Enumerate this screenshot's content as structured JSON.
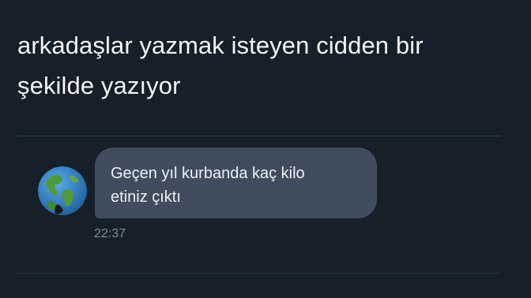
{
  "tweet": {
    "text_line1": "arkadaşlar yazmak isteyen cidden bir",
    "text_line2": "şekilde yazıyor"
  },
  "message": {
    "line1": "Geçen yıl kurbanda kaç kilo",
    "line2": "etiniz çıktı",
    "time": "22:37",
    "avatar_icon": "earth-globe-icon"
  },
  "colors": {
    "background": "#15202b",
    "bubble": "#3f4d5e",
    "text": "#f4f6f8",
    "muted": "#7f8c99"
  }
}
